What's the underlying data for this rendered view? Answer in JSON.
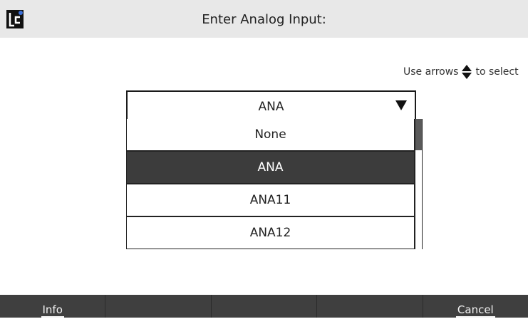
{
  "header": {
    "title": "Enter Analog Input:",
    "logo_icon": "lc-logo-icon"
  },
  "hint": {
    "prefix": "Use arrows",
    "arrows_icon": "up-down-arrows-icon",
    "suffix": "to select"
  },
  "select": {
    "value": "ANA",
    "caret_icon": "caret-down-icon"
  },
  "list": {
    "items": [
      {
        "label": "None",
        "selected": false
      },
      {
        "label": "ANA",
        "selected": true
      },
      {
        "label": "ANA11",
        "selected": false
      },
      {
        "label": "ANA12",
        "selected": false
      }
    ]
  },
  "footer": {
    "buttons": [
      "Info",
      "",
      "",
      "",
      "Cancel"
    ]
  },
  "colors": {
    "titlebar": "#e8e8e8",
    "selected_row": "#3c3c3c",
    "footer": "#3f3f3f",
    "logo_accent": "#3b6fd8"
  }
}
